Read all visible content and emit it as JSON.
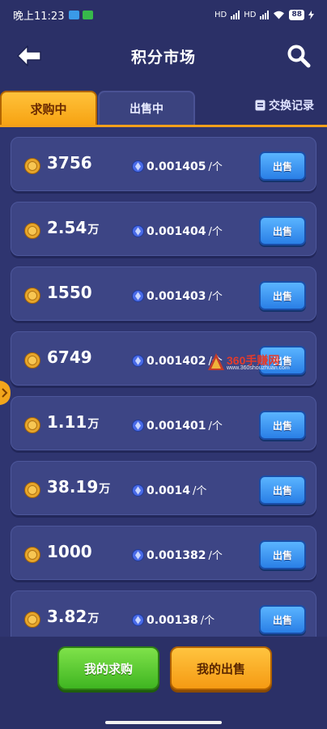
{
  "status_bar": {
    "time": "晚上11:23",
    "network_1": "HD",
    "network_2": "HD",
    "battery": "88"
  },
  "header": {
    "title": "积分市场",
    "back_icon": "arrow-left-icon",
    "search_icon": "search-icon"
  },
  "tabs": {
    "buy_label": "求购中",
    "sell_label": "出售中",
    "record_label": "交换记录"
  },
  "rows": [
    {
      "amount": "3756",
      "unit": "",
      "price": "0.001405",
      "per": "/个",
      "button": "出售"
    },
    {
      "amount": "2.54",
      "unit": "万",
      "price": "0.001404",
      "per": "/个",
      "button": "出售"
    },
    {
      "amount": "1550",
      "unit": "",
      "price": "0.001403",
      "per": "/个",
      "button": "出售"
    },
    {
      "amount": "6749",
      "unit": "",
      "price": "0.001402",
      "per": "/个",
      "button": "出售"
    },
    {
      "amount": "1.11",
      "unit": "万",
      "price": "0.001401",
      "per": "/个",
      "button": "出售"
    },
    {
      "amount": "38.19",
      "unit": "万",
      "price": "0.0014",
      "per": "/个",
      "button": "出售"
    },
    {
      "amount": "1000",
      "unit": "",
      "price": "0.001382",
      "per": "/个",
      "button": "出售"
    },
    {
      "amount": "3.82",
      "unit": "万",
      "price": "0.00138",
      "per": "/个",
      "button": "出售"
    }
  ],
  "watermark": {
    "text": "360手赚网",
    "url": "www.360shouzhuan.com"
  },
  "bottom": {
    "my_buy": "我的求购",
    "my_sell": "我的出售"
  },
  "colors": {
    "background": "#2b3067",
    "row": "#3d4585",
    "accent_orange": "#f7a313",
    "button_blue": "#2a7fe6",
    "button_green": "#3fb521"
  }
}
